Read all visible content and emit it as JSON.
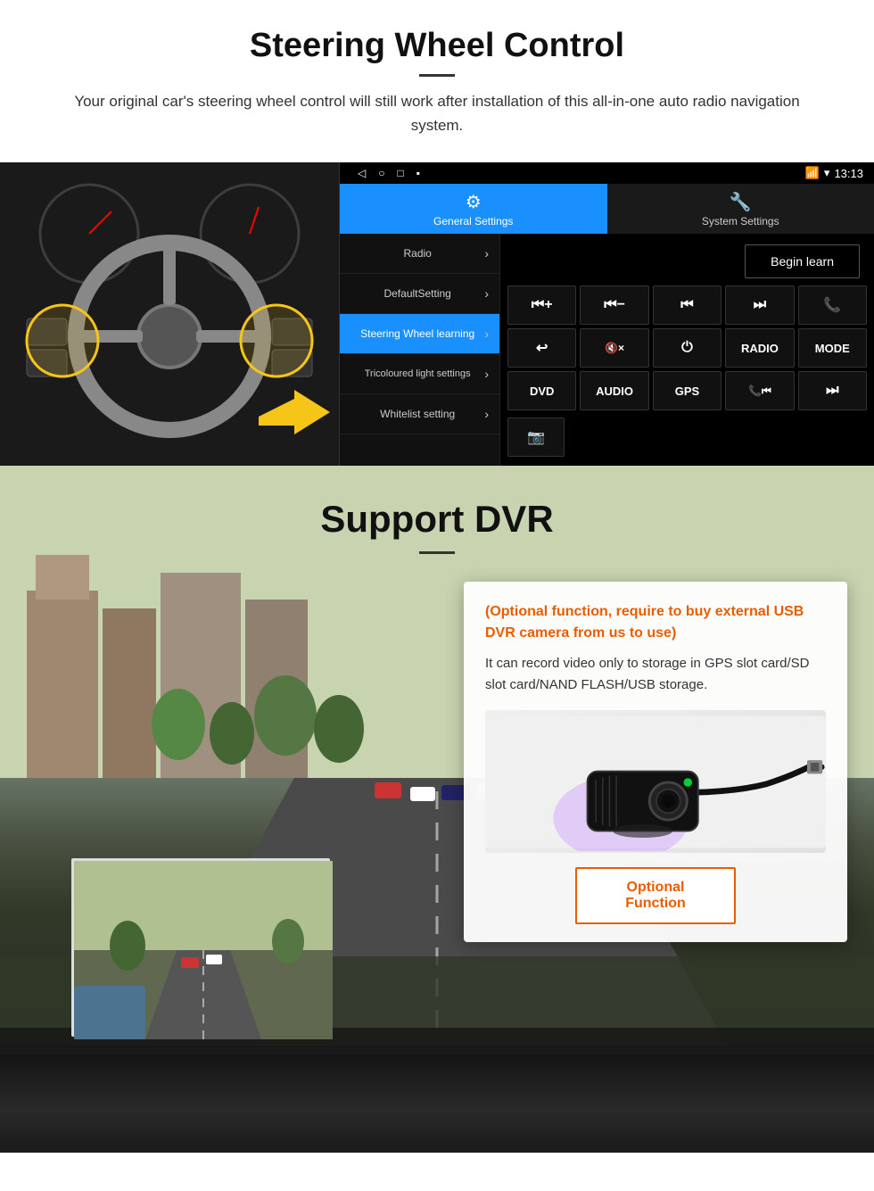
{
  "steering": {
    "title": "Steering Wheel Control",
    "subtitle": "Your original car's steering wheel control will still work after installation of this all-in-one auto radio navigation system.",
    "statusbar": {
      "time": "13:13",
      "icons": [
        "▽",
        "▾",
        "▪"
      ]
    },
    "tabs": {
      "general": {
        "icon": "⚙",
        "label": "General Settings"
      },
      "system": {
        "icon": "🔗",
        "label": "System Settings"
      }
    },
    "menu_items": [
      {
        "label": "Radio",
        "active": false
      },
      {
        "label": "DefaultSetting",
        "active": false
      },
      {
        "label": "Steering Wheel learning",
        "active": true
      },
      {
        "label": "Tricoloured light settings",
        "active": false
      },
      {
        "label": "Whitelist setting",
        "active": false
      }
    ],
    "begin_learn": "Begin learn",
    "control_buttons": [
      "⏮+",
      "⏮-",
      "⏮",
      "⏭",
      "📞",
      "↩",
      "🔇x",
      "⏻",
      "RADIO",
      "MODE",
      "DVD",
      "AUDIO",
      "GPS",
      "📞⏮",
      "⏭"
    ]
  },
  "dvr": {
    "title": "Support DVR",
    "optional_text": "(Optional function, require to buy external USB DVR camera from us to use)",
    "description": "It can record video only to storage in GPS slot card/SD slot card/NAND FLASH/USB storage.",
    "optional_button": "Optional Function"
  }
}
